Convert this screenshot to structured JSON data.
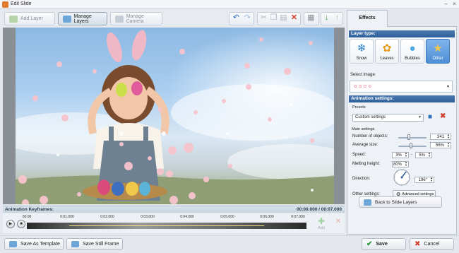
{
  "window": {
    "title": "Edit Slide"
  },
  "toolbar": {
    "add_layer": "Add Layer",
    "manage_layers": "Manage Layers",
    "manage_camera": "Manage Camera"
  },
  "tabs": {
    "effects": "Effects"
  },
  "layer_type": {
    "heading": "Layer type:",
    "options": [
      {
        "label": "Snow",
        "icon": "snowflake-icon",
        "selected": false
      },
      {
        "label": "Leaves",
        "icon": "leaf-icon",
        "selected": false
      },
      {
        "label": "Bubbles",
        "icon": "bubble-icon",
        "selected": false
      },
      {
        "label": "Other",
        "icon": "shapes-icon",
        "selected": true
      }
    ]
  },
  "select_image": {
    "label": "Select image:"
  },
  "animation": {
    "heading": "Animation settings:",
    "presets_label": "Presets",
    "preset_value": "Custom settings",
    "main_settings": "Main settings",
    "number_label": "Number of objects:",
    "number_value": "341",
    "avg_size_label": "Average size:",
    "avg_size_value": "56%",
    "speed_label": "Speed:",
    "speed_min": "3%",
    "speed_dash": "-",
    "speed_max": "5%",
    "melting_label": "Melting height:",
    "melting_value": "80%",
    "direction_label": "Direction:",
    "direction_value": "196°",
    "other_label": "Other settings:",
    "advanced_button": "Advanced settings"
  },
  "back_button": "Back to Slide Layers",
  "keyframes": {
    "label": "Animation Keyframes:",
    "time": "00:00.000 / 00:07.000",
    "ticks": [
      "00:00",
      "0:01.000",
      "0:02.000",
      "0:03.000",
      "0:04.000",
      "0:05.000",
      "0:06.000",
      "0:07.000"
    ],
    "add": "Add"
  },
  "bottom": {
    "save_template": "Save As Template",
    "save_frame": "Save Still Frame",
    "save": "Save",
    "cancel": "Cancel"
  },
  "colors": {
    "accent": "#2f5f99",
    "selected": "#4f8fd6",
    "save_green": "#2e9b3a",
    "cancel_red": "#d23b2b"
  }
}
